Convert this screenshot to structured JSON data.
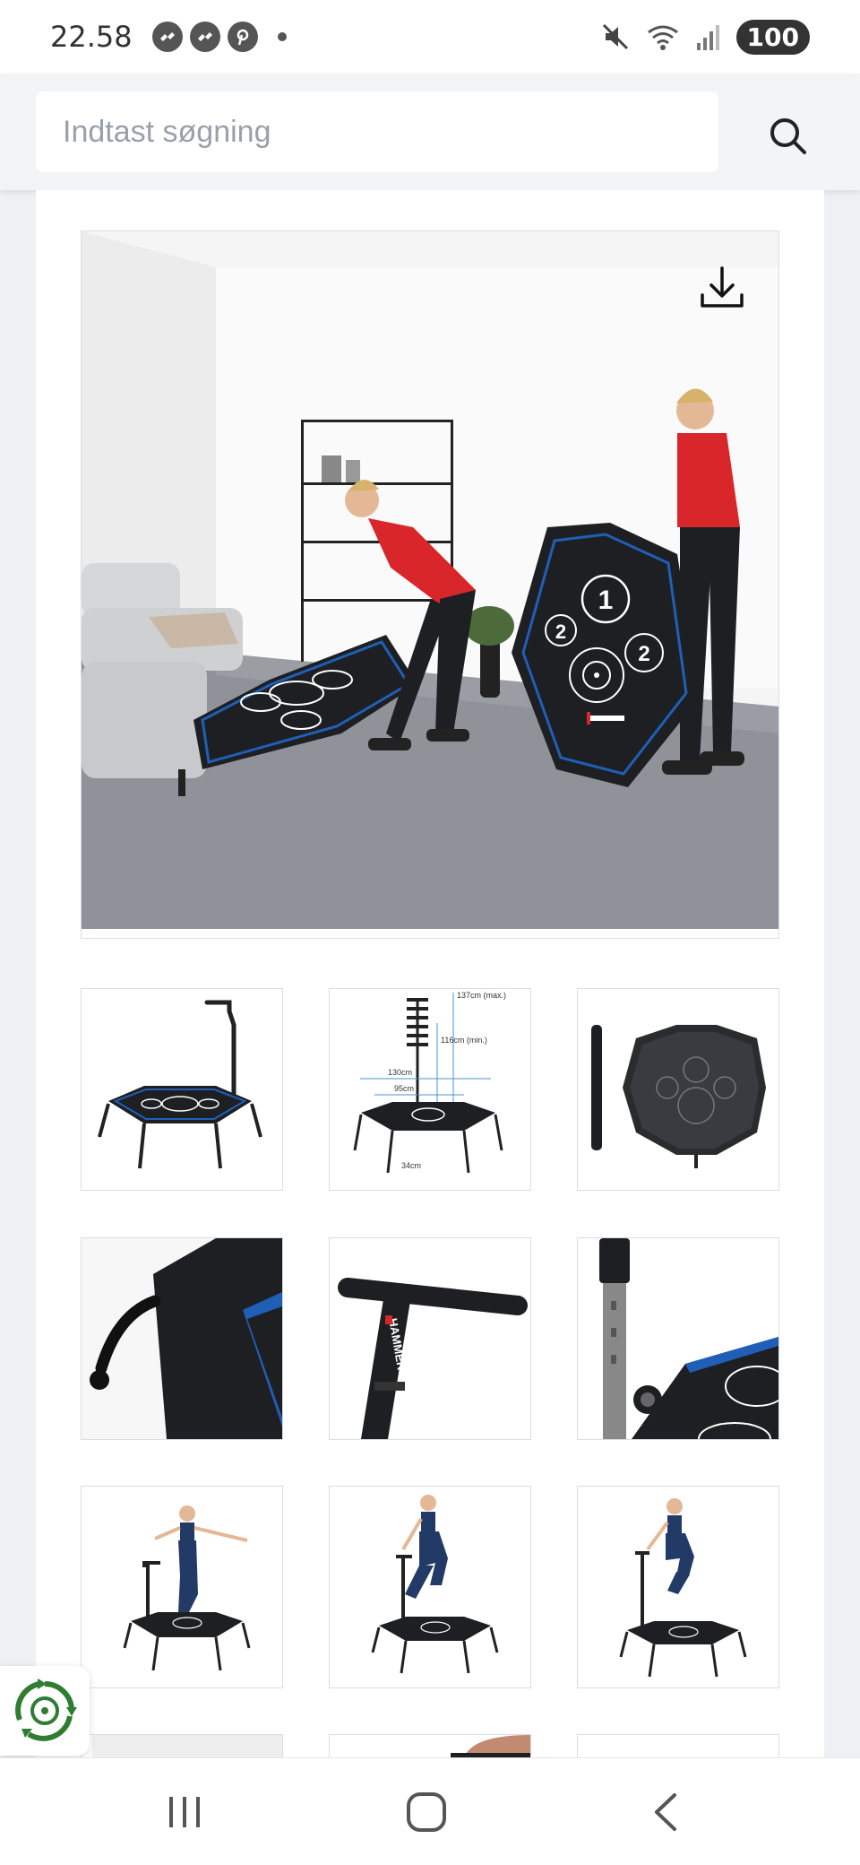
{
  "status_bar": {
    "time": "22.58",
    "battery": "100",
    "notification_icons": [
      "messenger-icon",
      "messenger-icon",
      "pinterest-icon"
    ],
    "system_icons": [
      "mute-icon",
      "wifi-icon",
      "signal-icon"
    ]
  },
  "search": {
    "placeholder": "Indtast søgning"
  },
  "product_gallery": {
    "main_image": {
      "alt": "Hammer hexagonal fitness trampoline being folded by two women"
    },
    "thumbnails": [
      {
        "name": "trampoline-with-handle"
      },
      {
        "name": "dimensions-diagram",
        "labels": [
          "137cm (max.)",
          "116cm (min.)",
          "130cm",
          "95cm",
          "34cm"
        ]
      },
      {
        "name": "folded-trampoline-top"
      },
      {
        "name": "frame-padding-closeup"
      },
      {
        "name": "t-handle-closeup",
        "brand": "HAMMER"
      },
      {
        "name": "height-adjust-closeup"
      },
      {
        "name": "woman-balancing"
      },
      {
        "name": "woman-bouncing"
      },
      {
        "name": "woman-jumping"
      }
    ]
  },
  "colors": {
    "accent_blue": "#1f5fb8",
    "trampoline_black": "#1e1f22",
    "shirt_red": "#d8262a",
    "floor_gray": "#8f9298",
    "logo_green": "#2e7d32"
  }
}
